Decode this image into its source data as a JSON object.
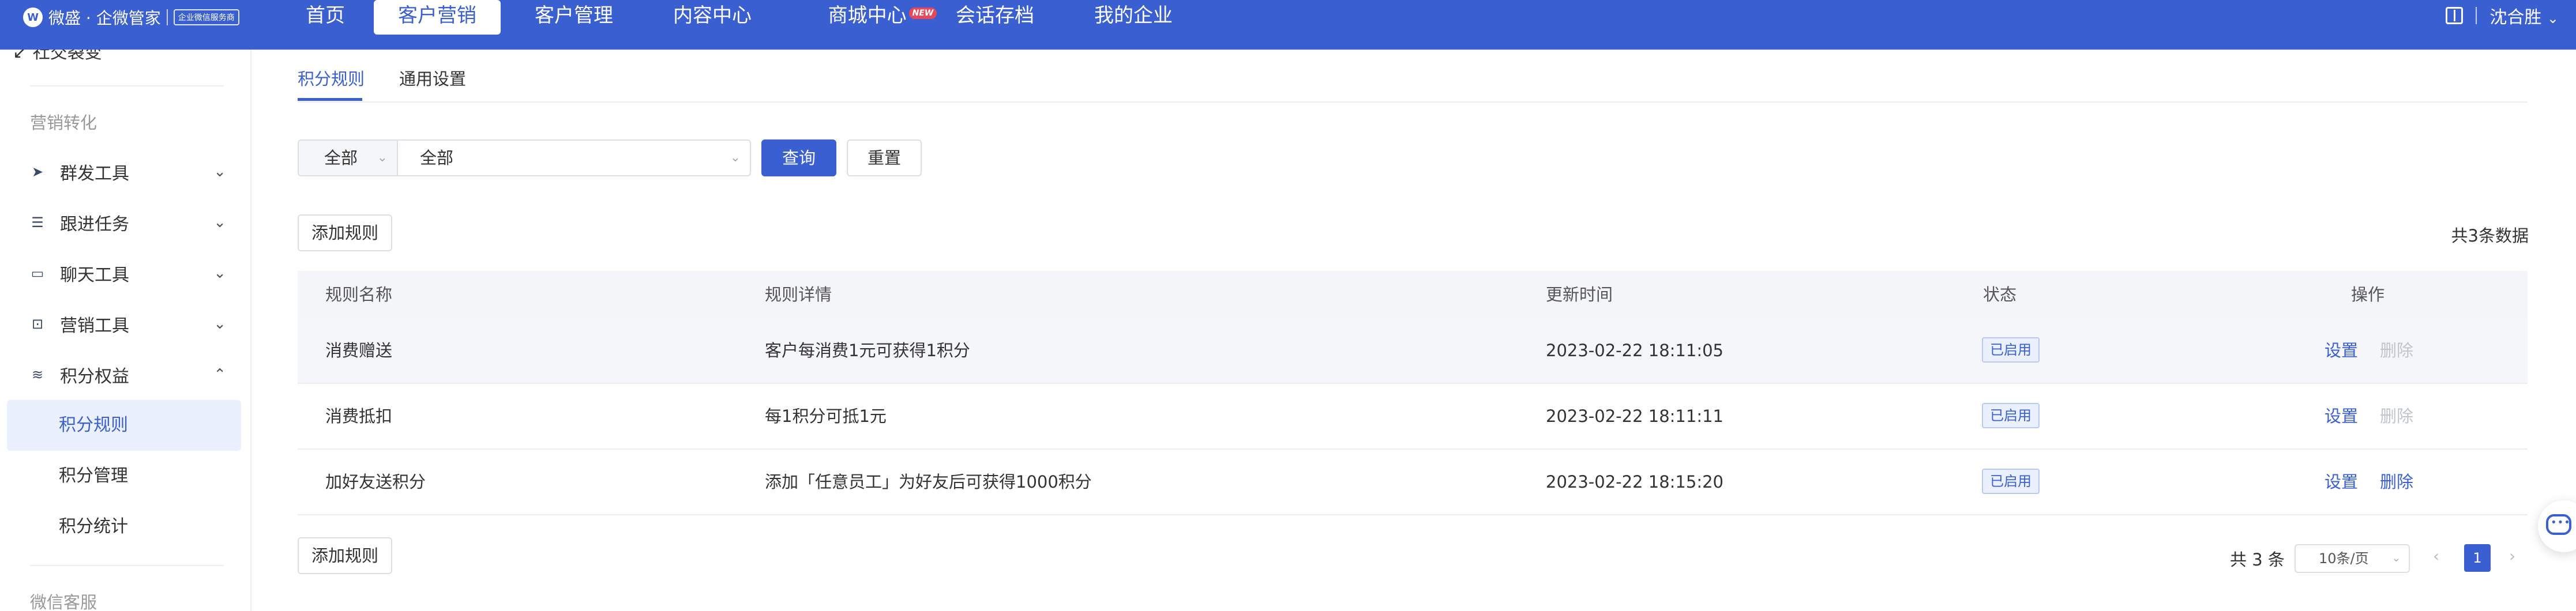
{
  "app": {
    "logo_text": "微盛 · 企微管家",
    "logo_badge": "企业微信服务商"
  },
  "nav": {
    "items": [
      {
        "label": "首页"
      },
      {
        "label": "客户营销",
        "active": true
      },
      {
        "label": "客户管理"
      },
      {
        "label": "内容中心"
      },
      {
        "label": "商城中心",
        "tag": "NEW"
      },
      {
        "label": "会话存档"
      },
      {
        "label": "我的企业"
      }
    ],
    "user_name": "沈合胜"
  },
  "sidebar": {
    "cut_item": "社交裂变",
    "section1": "营销转化",
    "items": [
      {
        "label": "群发工具",
        "icon": "send-icon",
        "expanded": false
      },
      {
        "label": "跟进任务",
        "icon": "task-list-icon",
        "expanded": false
      },
      {
        "label": "聊天工具",
        "icon": "chat-icon",
        "expanded": false
      },
      {
        "label": "营销工具",
        "icon": "marketing-icon",
        "expanded": false
      },
      {
        "label": "积分权益",
        "icon": "coins-icon",
        "expanded": true
      }
    ],
    "sub_items": [
      {
        "label": "积分规则",
        "active": true
      },
      {
        "label": "积分管理"
      },
      {
        "label": "积分统计"
      }
    ],
    "section2": "微信客服"
  },
  "tabs": [
    {
      "label": "积分规则",
      "active": true
    },
    {
      "label": "通用设置"
    }
  ],
  "filter": {
    "select1_value": "全部",
    "select2_value": "全部",
    "query_label": "查询",
    "reset_label": "重置"
  },
  "actions": {
    "add_rule_label": "添加规则",
    "total_text": "共3条数据"
  },
  "table": {
    "headers": [
      "规则名称",
      "规则详情",
      "更新时间",
      "状态",
      "操作"
    ],
    "rows": [
      {
        "name": "消费赠送",
        "detail": "客户每消费1元可获得1积分",
        "updated": "2023-02-22 18:11:05",
        "status": "已启用",
        "op_set": "设置",
        "op_delete": "删除",
        "delete_enabled": false
      },
      {
        "name": "消费抵扣",
        "detail": "每1积分可抵1元",
        "updated": "2023-02-22 18:11:11",
        "status": "已启用",
        "op_set": "设置",
        "op_delete": "删除",
        "delete_enabled": false
      },
      {
        "name": "加好友送积分",
        "detail": "添加「任意员工」为好友后可获得1000积分",
        "updated": "2023-02-22 18:15:20",
        "status": "已启用",
        "op_set": "设置",
        "op_delete": "删除",
        "delete_enabled": true
      }
    ]
  },
  "pagination": {
    "total_text": "共 3 条",
    "page_size": "10条/页",
    "current_page": "1"
  },
  "colors": {
    "brand": "#3a5fd0",
    "new_tag": "#e9485a"
  }
}
